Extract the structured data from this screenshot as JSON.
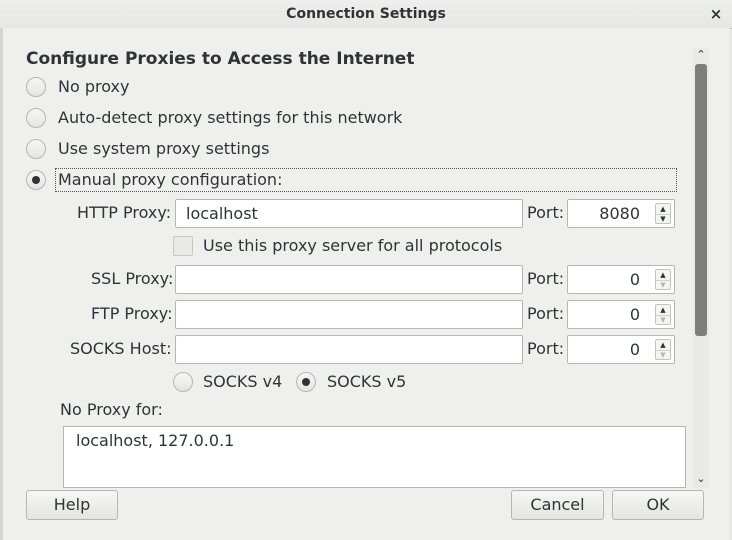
{
  "window": {
    "title": "Connection Settings",
    "close_glyph": "×",
    "close_icon": "close-icon"
  },
  "section_title": "Configure Proxies to Access the Internet",
  "proxy_mode": {
    "options": [
      {
        "label": "No proxy",
        "selected": false
      },
      {
        "label": "Auto-detect proxy settings for this network",
        "selected": false
      },
      {
        "label": "Use system proxy settings",
        "selected": false
      },
      {
        "label": "Manual proxy configuration:",
        "selected": true
      }
    ]
  },
  "manual": {
    "http": {
      "label": "HTTP Proxy:",
      "value": "localhost",
      "port_label": "Port:",
      "port": "8080"
    },
    "use_for_all": {
      "label": "Use this proxy server for all protocols",
      "checked": false
    },
    "ssl": {
      "label": "SSL Proxy:",
      "value": "",
      "port_label": "Port:",
      "port": "0"
    },
    "ftp": {
      "label": "FTP Proxy:",
      "value": "",
      "port_label": "Port:",
      "port": "0"
    },
    "socks": {
      "label": "SOCKS Host:",
      "value": "",
      "port_label": "Port:",
      "port": "0"
    },
    "socks_versions": [
      {
        "label": "SOCKS v4",
        "selected": false
      },
      {
        "label": "SOCKS v5",
        "selected": true
      }
    ]
  },
  "no_proxy": {
    "label": "No Proxy for:",
    "value": "localhost, 127.0.0.1"
  },
  "buttons": {
    "help": "Help",
    "cancel": "Cancel",
    "ok": "OK"
  },
  "glyphs": {
    "spin_up": "▲",
    "spin_down": "▼",
    "scroll_up": "⌃",
    "scroll_down": "⌄"
  },
  "colors": {
    "background": "#efefee",
    "scroll_thumb": "#7e7e7d"
  }
}
